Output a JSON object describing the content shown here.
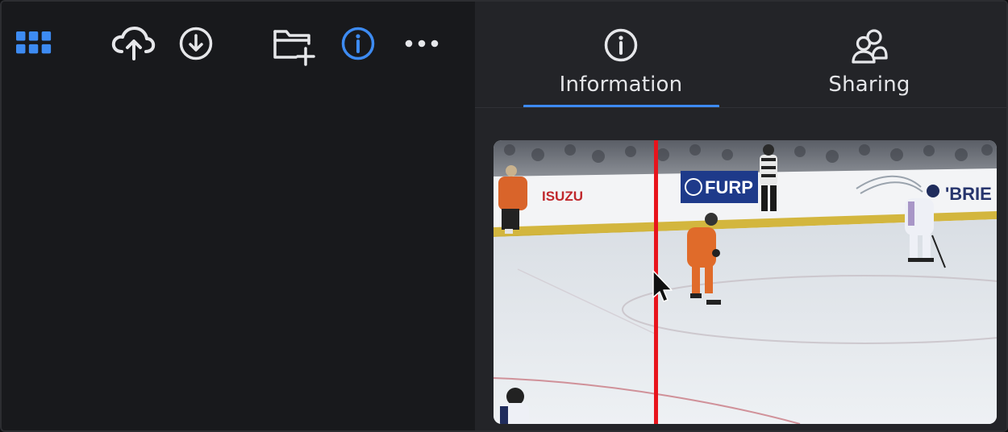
{
  "toolbar": {
    "apps_icon": "grid-icon",
    "upload_icon": "cloud-upload-icon",
    "download_icon": "download-icon",
    "new_folder_icon": "folder-plus-icon",
    "info_icon": "info-icon",
    "more_icon": "more-icon"
  },
  "tabs": [
    {
      "label": "Information",
      "icon": "info-icon",
      "active": true
    },
    {
      "label": "Sharing",
      "icon": "people-icon",
      "active": false
    }
  ],
  "preview": {
    "ad_isuzu": "ISUZU",
    "ad_furp": "FURP",
    "ad_brie": "'BRIE"
  },
  "colors": {
    "accent": "#3d8bf2",
    "playhead": "#e8141c",
    "panel_dark": "#18191c",
    "panel_right": "#232428"
  }
}
